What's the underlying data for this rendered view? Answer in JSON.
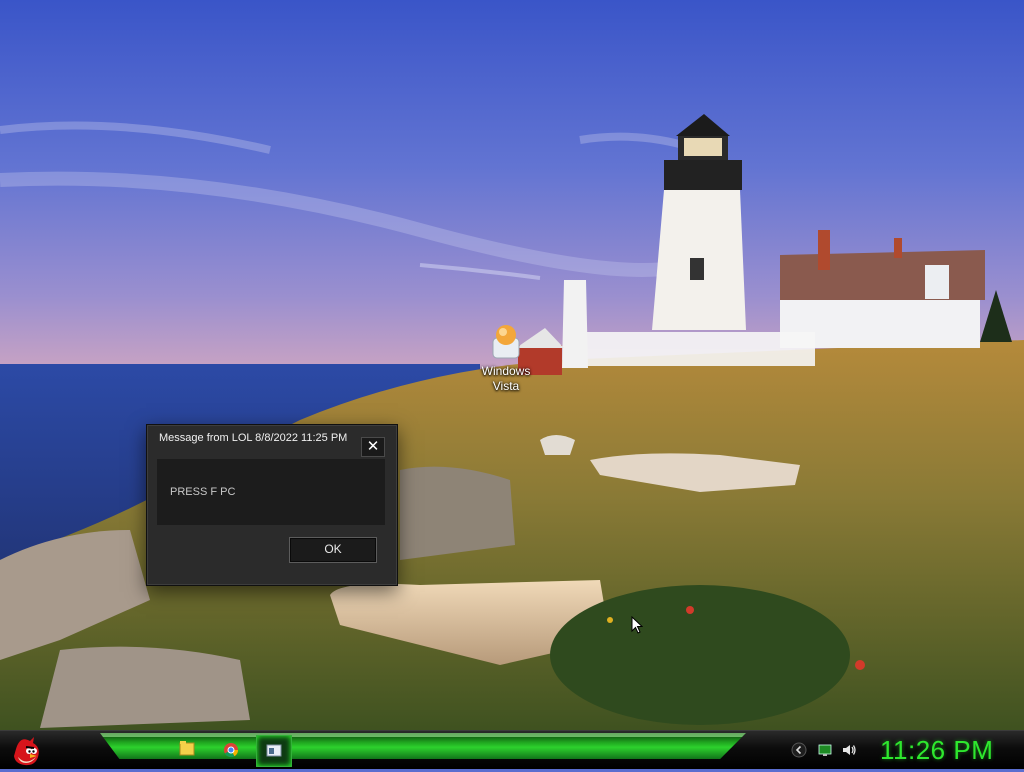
{
  "desktop": {
    "wallpaper_icon": "lighthouse-landscape-wallpaper",
    "icons": [
      {
        "label": "Windows\nVista",
        "icon": "vista-installer-icon"
      }
    ]
  },
  "dialog": {
    "title": "Message from LOL 8/8/2022 11:25 PM",
    "message": "PRESS F PC",
    "ok_label": "OK",
    "close_label": "✕"
  },
  "taskbar": {
    "start_icon": "angry-bird-icon",
    "items": [
      {
        "icon": "folder-icon",
        "active": false
      },
      {
        "icon": "chrome-icon",
        "active": false
      },
      {
        "icon": "window-app-icon",
        "active": true
      }
    ],
    "tray": [
      {
        "icon": "chevron-left-icon"
      },
      {
        "icon": "monitor-icon"
      },
      {
        "icon": "speaker-icon"
      }
    ],
    "clock": "11:26 PM",
    "accent_color": "#2dd12d"
  }
}
